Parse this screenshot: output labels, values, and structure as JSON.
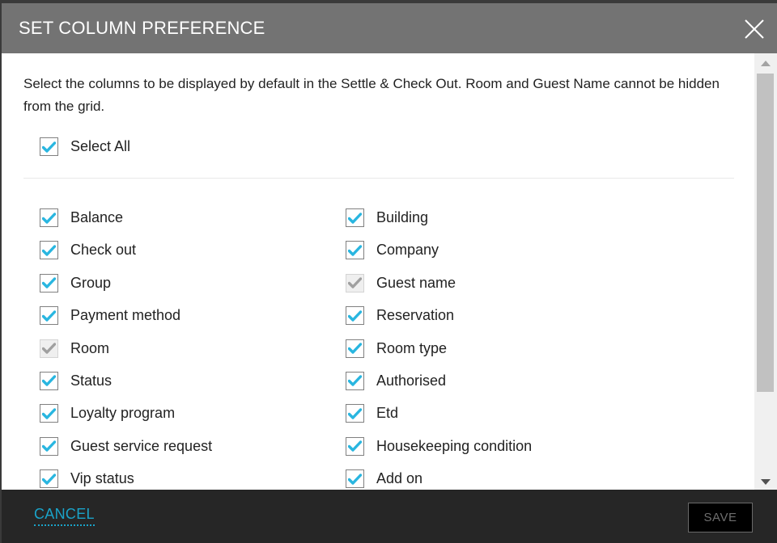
{
  "dialog": {
    "title": "SET COLUMN PREFERENCE",
    "close_icon": "close-icon",
    "description": "Select the columns to be displayed by default in the Settle & Check Out. Room and Guest Name cannot be hidden from the grid.",
    "select_all": {
      "label": "Select All",
      "checked": true
    },
    "columns_left": [
      {
        "label": "Balance",
        "checked": true,
        "disabled": false
      },
      {
        "label": "Check out",
        "checked": true,
        "disabled": false
      },
      {
        "label": "Group",
        "checked": true,
        "disabled": false
      },
      {
        "label": "Payment method",
        "checked": true,
        "disabled": false
      },
      {
        "label": "Room",
        "checked": true,
        "disabled": true
      },
      {
        "label": "Status",
        "checked": true,
        "disabled": false
      },
      {
        "label": "Loyalty program",
        "checked": true,
        "disabled": false
      },
      {
        "label": "Guest service request",
        "checked": true,
        "disabled": false
      },
      {
        "label": "Vip status",
        "checked": true,
        "disabled": false
      }
    ],
    "columns_right": [
      {
        "label": "Building",
        "checked": true,
        "disabled": false
      },
      {
        "label": "Company",
        "checked": true,
        "disabled": false
      },
      {
        "label": "Guest name",
        "checked": true,
        "disabled": true
      },
      {
        "label": "Reservation",
        "checked": true,
        "disabled": false
      },
      {
        "label": "Room type",
        "checked": true,
        "disabled": false
      },
      {
        "label": "Authorised",
        "checked": true,
        "disabled": false
      },
      {
        "label": "Etd",
        "checked": true,
        "disabled": false
      },
      {
        "label": "Housekeeping condition",
        "checked": true,
        "disabled": false
      },
      {
        "label": "Add on",
        "checked": true,
        "disabled": false
      }
    ],
    "footer": {
      "cancel_label": "CANCEL",
      "save_label": "SAVE",
      "save_enabled": false
    }
  },
  "colors": {
    "header_bg": "#737373",
    "footer_bg": "#262626",
    "check_active": "#29b6e0",
    "check_disabled": "#a0a0a0",
    "cancel_link": "#1aa3c9"
  }
}
